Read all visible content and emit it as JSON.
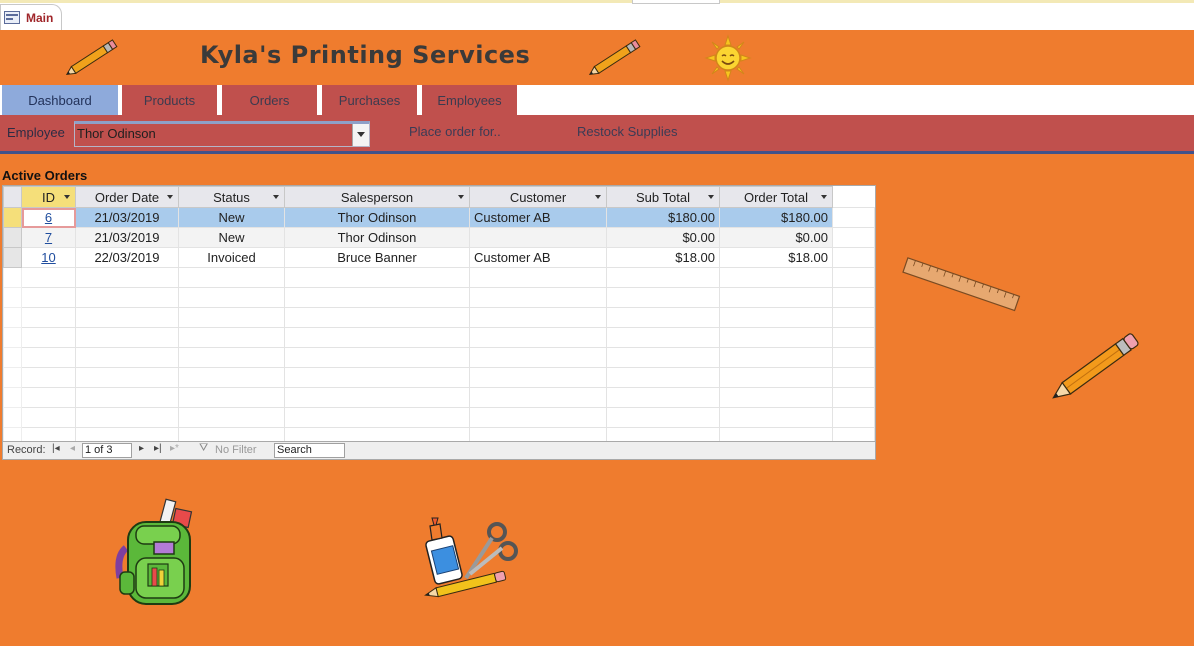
{
  "window": {
    "object_tab": "Main"
  },
  "form": {
    "title": "Kyla's Printing Services",
    "tabs": [
      {
        "label": "Dashboard",
        "active": true
      },
      {
        "label": "Products",
        "active": false
      },
      {
        "label": "Orders",
        "active": false
      },
      {
        "label": "Purchases",
        "active": false
      },
      {
        "label": "Employees",
        "active": false
      }
    ],
    "employee_label": "Employee",
    "employee_value": "Thor Odinson",
    "place_order_link": "Place order for..",
    "restock_link": "Restock Supplies"
  },
  "orders": {
    "section_label": "Active Orders",
    "columns": [
      "ID",
      "Order Date",
      "Status",
      "Salesperson",
      "Customer",
      "Sub Total",
      "Order Total"
    ],
    "rows": [
      {
        "id": "6",
        "order_date": "21/03/2019",
        "status": "New",
        "salesperson": "Thor Odinson",
        "customer": "Customer AB",
        "sub_total": "$180.00",
        "order_total": "$180.00"
      },
      {
        "id": "7",
        "order_date": "21/03/2019",
        "status": "New",
        "salesperson": "Thor Odinson",
        "customer": "",
        "sub_total": "$0.00",
        "order_total": "$0.00"
      },
      {
        "id": "10",
        "order_date": "22/03/2019",
        "status": "Invoiced",
        "salesperson": "Bruce Banner",
        "customer": "Customer AB",
        "sub_total": "$18.00",
        "order_total": "$18.00"
      }
    ]
  },
  "navigation": {
    "record_label": "Record:",
    "record_position": "1 of 3",
    "filter_label": "No Filter",
    "search_placeholder": "Search"
  },
  "colors": {
    "form_background": "#ef7c2e",
    "tab_inactive": "#c0504d",
    "tab_active": "#8eaadb",
    "selected_row": "#a9cbec"
  },
  "decorations": [
    "pencil-icon",
    "pencil-icon",
    "sun-icon",
    "ruler-icon",
    "pencil-icon",
    "backpack-icon",
    "glue-scissors-icon"
  ]
}
